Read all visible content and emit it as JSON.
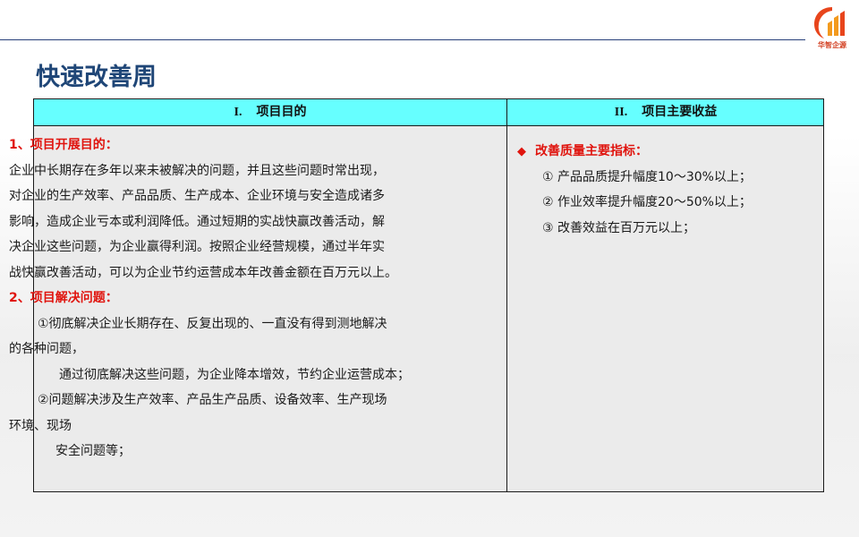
{
  "brand": {
    "logo_text": "华智企源",
    "accent_color": "#e8451c",
    "line_color": "#27407a"
  },
  "page": {
    "title": "快速改善周"
  },
  "table": {
    "header_left_num": "I.",
    "header_left_label": "项目目的",
    "header_right_num": "II.",
    "header_right_label": "项目主要收益",
    "header_color": "#66ffff",
    "left": {
      "heading1": "1、项目开展目的：",
      "para1": [
        "企业中长期存在多年以来未被解决的问题，并且这些问题时常出现，",
        "对企业的生产效率、产品品质、生产成本、企业环境与安全造成诸多",
        "影响，造成企业亏本或利润降低。通过短期的实战快赢改善活动，解",
        "决企业这些问题，为企业赢得利润。按照企业经营规模，通过半年实",
        "战快赢改善活动，可以为企业节约运营成本年改善金额在百万元以上。"
      ],
      "heading2": "2、项目解决问题：",
      "item1_line1": "①彻底解决企业长期存在、反复出现的、一直没有得到测地解决",
      "item1_line2": "的各种问题，",
      "item1_line3": "通过彻底解决这些问题，为企业降本增效，节约企业运营成本；",
      "item2_line1": "②问题解决涉及生产效率、产品生产品质、设备效率、生产现场",
      "item2_line2": "环境、现场",
      "item2_line3": "安全问题等；"
    },
    "right": {
      "bullet_icon": "red-diamond-icon",
      "heading": "改善质量主要指标：",
      "items": [
        "①  产品品质提升幅度10～30%以上；",
        "②  作业效率提升幅度20～50%以上；",
        "③  改善效益在百万元以上；"
      ]
    }
  }
}
